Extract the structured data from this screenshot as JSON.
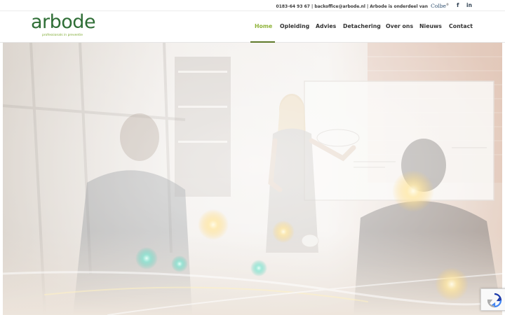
{
  "topbar": {
    "phone": "0183-64 93 67",
    "email": "backoffice@arbode.nl",
    "group_text": "Arbode is onderdeel van",
    "group_brand": "Colbe",
    "social": [
      {
        "icon": "facebook-icon",
        "glyph": "f"
      },
      {
        "icon": "linkedin-icon",
        "glyph": "in"
      }
    ]
  },
  "logo": {
    "word": "arbode",
    "tagline": "professionals in preventie"
  },
  "nav": {
    "items": [
      {
        "label": "Home",
        "active": true
      },
      {
        "label": "Opleiding"
      },
      {
        "label": "Advies"
      },
      {
        "label": "Detachering"
      },
      {
        "label": "Over ons"
      },
      {
        "label": "Nieuws"
      },
      {
        "label": "Contact"
      }
    ]
  },
  "hero": {
    "image": "office-presentation-photo"
  },
  "colors": {
    "brand_green": "#2f6e36",
    "nav_active": "#8fb33a",
    "text_dark": "#333333"
  }
}
